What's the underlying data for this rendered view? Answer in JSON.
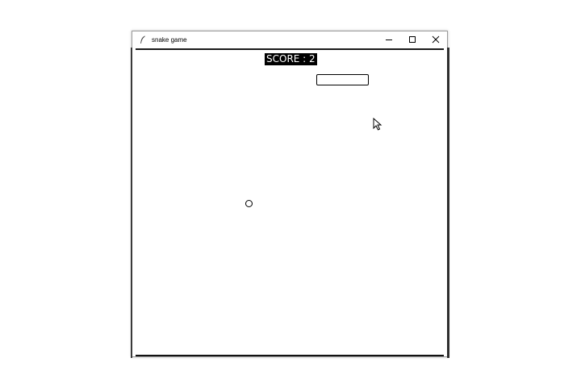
{
  "window": {
    "title": "snake game",
    "app_icon": "feather-icon",
    "controls": {
      "minimize_icon": "minimize-icon",
      "maximize_icon": "maximize-icon",
      "close_icon": "close-icon"
    }
  },
  "game": {
    "score_text": "SCORE : 2",
    "food_icon": "circle-food-icon",
    "cursor_icon": "mouse-pointer-icon"
  },
  "colors": {
    "background": "#ffffff",
    "score_bg": "#000000",
    "score_fg": "#ffffff"
  }
}
